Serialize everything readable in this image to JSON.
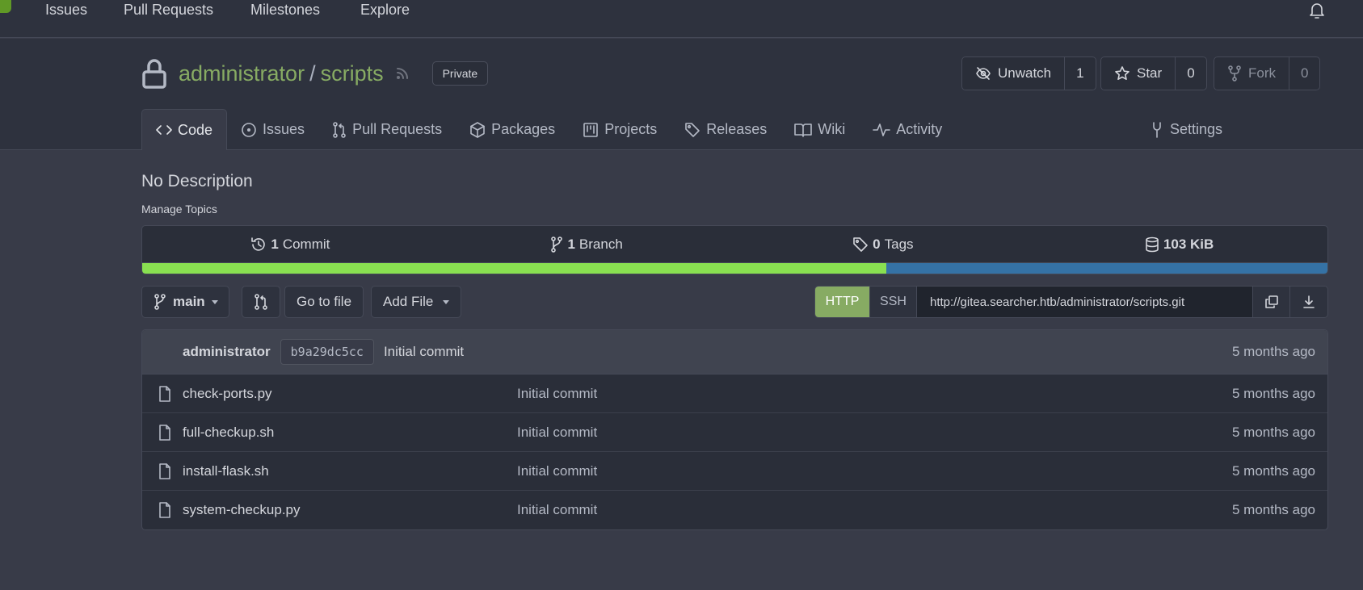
{
  "nav": {
    "items": [
      "Issues",
      "Pull Requests",
      "Milestones",
      "Explore"
    ],
    "logo_color": "#609926"
  },
  "repo": {
    "owner": "administrator",
    "separator": "/",
    "name": "scripts",
    "visibility": "Private",
    "watch": {
      "label": "Unwatch",
      "count": "1"
    },
    "star": {
      "label": "Star",
      "count": "0"
    },
    "fork": {
      "label": "Fork",
      "count": "0"
    },
    "accent_color": "#87ab63"
  },
  "tabs": [
    {
      "label": "Code",
      "icon": "code-icon",
      "active": true
    },
    {
      "label": "Issues",
      "icon": "issue-icon"
    },
    {
      "label": "Pull Requests",
      "icon": "pull-request-icon"
    },
    {
      "label": "Packages",
      "icon": "package-icon"
    },
    {
      "label": "Projects",
      "icon": "project-icon"
    },
    {
      "label": "Releases",
      "icon": "tag-icon"
    },
    {
      "label": "Wiki",
      "icon": "book-icon"
    },
    {
      "label": "Activity",
      "icon": "pulse-icon"
    }
  ],
  "settings_label": "Settings",
  "description": "No Description",
  "manage_topics": "Manage Topics",
  "stats": {
    "commits": {
      "count": "1",
      "label": "Commit"
    },
    "branches": {
      "count": "1",
      "label": "Branch"
    },
    "tags": {
      "count": "0",
      "label": "Tags"
    },
    "size": "103 KiB"
  },
  "language_bar": [
    {
      "color": "#89e051",
      "percent": 62.8
    },
    {
      "color": "#3572A5",
      "percent": 37.2
    }
  ],
  "toolbar": {
    "branch": "main",
    "go_to_file": "Go to file",
    "add_file": "Add File",
    "http": "HTTP",
    "ssh": "SSH",
    "clone_url": "http://gitea.searcher.htb/administrator/scripts.git",
    "active_protocol_color": "#87ab63"
  },
  "latest_commit": {
    "author": "administrator",
    "sha": "b9a29dc5cc",
    "message": "Initial commit",
    "time": "5 months ago"
  },
  "files": [
    {
      "name": "check-ports.py",
      "message": "Initial commit",
      "time": "5 months ago"
    },
    {
      "name": "full-checkup.sh",
      "message": "Initial commit",
      "time": "5 months ago"
    },
    {
      "name": "install-flask.sh",
      "message": "Initial commit",
      "time": "5 months ago"
    },
    {
      "name": "system-checkup.py",
      "message": "Initial commit",
      "time": "5 months ago"
    }
  ]
}
